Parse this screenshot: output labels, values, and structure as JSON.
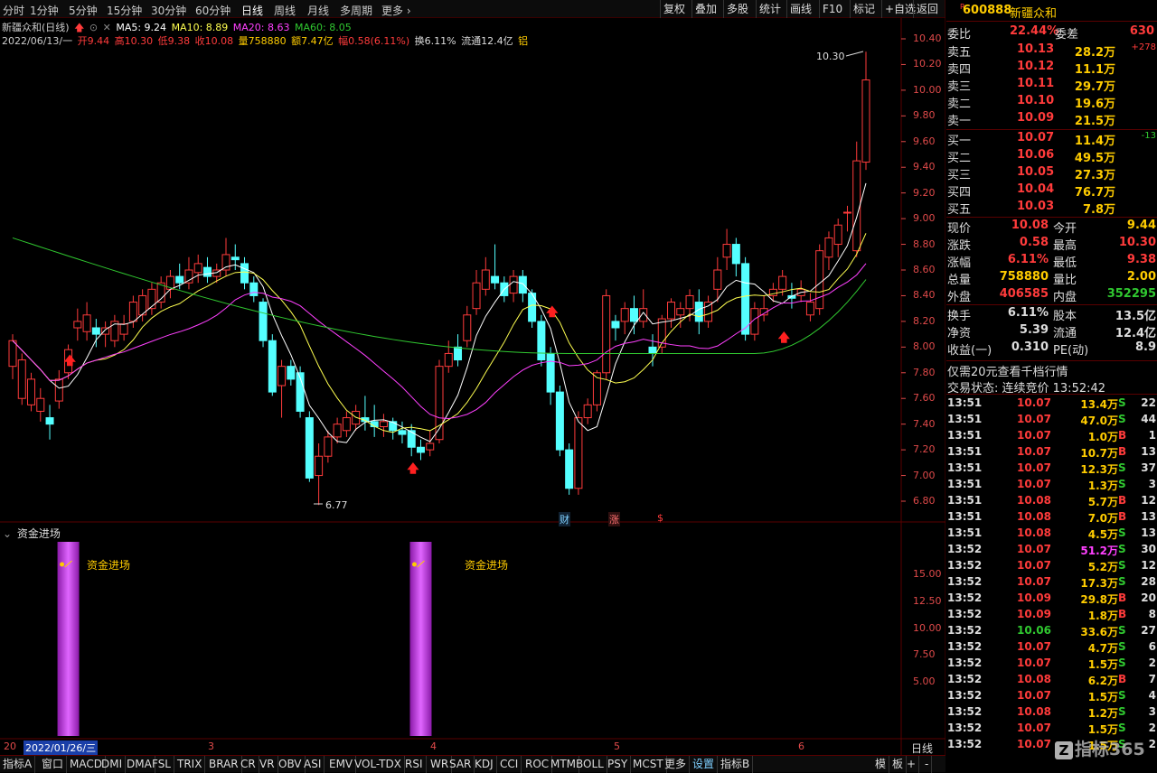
{
  "toolbar": {
    "periods": [
      "分时",
      "1分钟",
      "5分钟",
      "15分钟",
      "30分钟",
      "60分钟",
      "日线",
      "周线",
      "月线",
      "多周期",
      "更多"
    ],
    "active_period": "日线",
    "buttons": [
      "复权",
      "叠加",
      "多股",
      "统计",
      "画线",
      "F10",
      "标记",
      "+自选",
      "返回"
    ]
  },
  "header": {
    "title": "新疆众和(日线)",
    "ma5": "MA5: 9.24",
    "ma10": "MA10: 8.89",
    "ma20": "MA20: 8.63",
    "ma60": "MA60: 8.05",
    "date": "2022/06/13/一",
    "open": "开9.44",
    "high": "高10.30",
    "low": "低9.38",
    "close": "收10.08",
    "vol": "量758880",
    "amount": "额7.47亿",
    "change": "幅0.58(6.11%)",
    "turnover": "换6.11%",
    "float": "流通12.4亿",
    "sector": "铝"
  },
  "price_axis": [
    "10.40",
    "10.20",
    "10.00",
    "9.80",
    "9.60",
    "9.40",
    "9.20",
    "9.00",
    "8.80",
    "8.60",
    "8.40",
    "8.20",
    "8.00",
    "7.80",
    "7.60",
    "7.40",
    "7.20",
    "7.00",
    "6.80"
  ],
  "annotations": {
    "high_mark": "10.30",
    "low_mark": "6.77",
    "badge_cai": "财",
    "badge_zhang": "涨",
    "badge_dollar": "$"
  },
  "indicator": {
    "title": "资金进场",
    "signal_label": "资金进场",
    "axis": [
      "15.00",
      "12.50",
      "10.00",
      "7.50",
      "5.00"
    ]
  },
  "date_axis": {
    "selected": "2022/01/26/三",
    "prefix": "20",
    "months": [
      "3",
      "4",
      "5",
      "6"
    ],
    "period": "日线"
  },
  "bottom_tabs": [
    "指标A",
    "窗口",
    "MACD",
    "DMI",
    "DMA",
    "FSL",
    "TRIX",
    "BRAR",
    "CR",
    "VR",
    "OBV",
    "ASI",
    "EMV",
    "VOL-TDX",
    "RSI",
    "WR",
    "SAR",
    "KDJ",
    "CCI",
    "ROC",
    "MTM",
    "BOLL",
    "PSY",
    "MCST",
    "更多",
    "设置",
    "指标B",
    "模",
    "板"
  ],
  "quote": {
    "code": "600888",
    "name": "新疆众和",
    "weibi_label": "委比",
    "weibi": "22.44%",
    "weicha_label": "委差",
    "weicha": "630",
    "asks": [
      {
        "label": "卖五",
        "price": "10.13",
        "vol": "28.2万",
        "extra": "+278"
      },
      {
        "label": "卖四",
        "price": "10.12",
        "vol": "11.1万",
        "extra": ""
      },
      {
        "label": "卖三",
        "price": "10.11",
        "vol": "29.7万",
        "extra": ""
      },
      {
        "label": "卖二",
        "price": "10.10",
        "vol": "19.6万",
        "extra": ""
      },
      {
        "label": "卖一",
        "price": "10.09",
        "vol": "21.5万",
        "extra": ""
      }
    ],
    "bids": [
      {
        "label": "买一",
        "price": "10.07",
        "vol": "11.4万",
        "extra": "-13"
      },
      {
        "label": "买二",
        "price": "10.06",
        "vol": "49.5万",
        "extra": ""
      },
      {
        "label": "买三",
        "price": "10.05",
        "vol": "27.3万",
        "extra": ""
      },
      {
        "label": "买四",
        "price": "10.04",
        "vol": "76.7万",
        "extra": ""
      },
      {
        "label": "买五",
        "price": "10.03",
        "vol": "7.8万",
        "extra": ""
      }
    ],
    "stats": [
      {
        "l1": "现价",
        "v1": "10.08",
        "l2": "今开",
        "v2": "9.44"
      },
      {
        "l1": "涨跌",
        "v1": "0.58",
        "l2": "最高",
        "v2": "10.30"
      },
      {
        "l1": "涨幅",
        "v1": "6.11%",
        "l2": "最低",
        "v2": "9.38"
      },
      {
        "l1": "总量",
        "v1": "758880",
        "l2": "量比",
        "v2": "2.00"
      },
      {
        "l1": "外盘",
        "v1": "406585",
        "l2": "内盘",
        "v2": "352295"
      }
    ],
    "stats2": [
      {
        "l1": "换手",
        "v1": "6.11%",
        "l2": "股本",
        "v2": "13.5亿"
      },
      {
        "l1": "净资",
        "v1": "5.39",
        "l2": "流通",
        "v2": "12.4亿"
      },
      {
        "l1": "收益(一)",
        "v1": "0.310",
        "l2": "PE(动)",
        "v2": "8.9"
      }
    ],
    "promo": "仅需20元查看千档行情",
    "status": "交易状态: 连续竞价 13:52:42",
    "ticks": [
      {
        "t": "13:51",
        "p": "10.07",
        "v": "13.4万",
        "s": "S",
        "n": "22"
      },
      {
        "t": "13:51",
        "p": "10.07",
        "v": "47.0万",
        "s": "S",
        "n": "44"
      },
      {
        "t": "13:51",
        "p": "10.07",
        "v": "1.0万",
        "s": "B",
        "n": "1"
      },
      {
        "t": "13:51",
        "p": "10.07",
        "v": "10.7万",
        "s": "B",
        "n": "13"
      },
      {
        "t": "13:51",
        "p": "10.07",
        "v": "12.3万",
        "s": "S",
        "n": "37"
      },
      {
        "t": "13:51",
        "p": "10.07",
        "v": "1.3万",
        "s": "S",
        "n": "3"
      },
      {
        "t": "13:51",
        "p": "10.08",
        "v": "5.7万",
        "s": "B",
        "n": "12"
      },
      {
        "t": "13:51",
        "p": "10.08",
        "v": "7.0万",
        "s": "B",
        "n": "13"
      },
      {
        "t": "13:51",
        "p": "10.08",
        "v": "4.5万",
        "s": "S",
        "n": "13"
      },
      {
        "t": "13:52",
        "p": "10.07",
        "v": "51.2万",
        "s": "S",
        "n": "30"
      },
      {
        "t": "13:52",
        "p": "10.07",
        "v": "5.2万",
        "s": "S",
        "n": "12"
      },
      {
        "t": "13:52",
        "p": "10.07",
        "v": "17.3万",
        "s": "S",
        "n": "28"
      },
      {
        "t": "13:52",
        "p": "10.09",
        "v": "29.8万",
        "s": "B",
        "n": "20"
      },
      {
        "t": "13:52",
        "p": "10.09",
        "v": "1.8万",
        "s": "B",
        "n": "8"
      },
      {
        "t": "13:52",
        "p": "10.06",
        "v": "33.6万",
        "s": "S",
        "n": "27"
      },
      {
        "t": "13:52",
        "p": "10.07",
        "v": "4.7万",
        "s": "S",
        "n": "6"
      },
      {
        "t": "13:52",
        "p": "10.07",
        "v": "1.5万",
        "s": "S",
        "n": "2"
      },
      {
        "t": "13:52",
        "p": "10.08",
        "v": "6.2万",
        "s": "B",
        "n": "7"
      },
      {
        "t": "13:52",
        "p": "10.07",
        "v": "1.5万",
        "s": "S",
        "n": "4"
      },
      {
        "t": "13:52",
        "p": "10.08",
        "v": "1.2万",
        "s": "S",
        "n": "3"
      },
      {
        "t": "13:52",
        "p": "10.07",
        "v": "1.5万",
        "s": "S",
        "n": "2"
      },
      {
        "t": "13:52",
        "p": "10.07",
        "v": "1.5万",
        "s": "S",
        "n": "2"
      }
    ],
    "watermark": "指标365"
  },
  "chart_data": {
    "type": "candlestick",
    "title": "新疆众和(日线)",
    "ylim": [
      6.7,
      10.45
    ],
    "candles": [
      [
        7.85,
        8.05,
        7.75,
        8.1
      ],
      [
        7.6,
        7.9,
        7.55,
        7.95
      ],
      [
        7.55,
        7.75,
        7.5,
        7.8
      ],
      [
        7.5,
        7.6,
        7.42,
        7.68
      ],
      [
        7.45,
        7.4,
        7.28,
        7.55
      ],
      [
        7.58,
        7.75,
        7.52,
        7.82
      ],
      [
        7.8,
        7.98,
        7.75,
        8.02
      ],
      [
        8.15,
        8.2,
        8.05,
        8.3
      ],
      [
        8.12,
        8.25,
        8.05,
        8.35
      ],
      [
        8.15,
        8.1,
        8.0,
        8.22
      ],
      [
        8.1,
        8.15,
        8.0,
        8.2
      ],
      [
        8.05,
        8.2,
        8.0,
        8.25
      ],
      [
        8.1,
        8.18,
        8.05,
        8.25
      ],
      [
        8.2,
        8.35,
        8.15,
        8.4
      ],
      [
        8.25,
        8.4,
        8.2,
        8.45
      ],
      [
        8.3,
        8.45,
        8.25,
        8.5
      ],
      [
        8.35,
        8.5,
        8.3,
        8.55
      ],
      [
        8.45,
        8.55,
        8.38,
        8.6
      ],
      [
        8.55,
        8.5,
        8.45,
        8.65
      ],
      [
        8.5,
        8.6,
        8.45,
        8.7
      ],
      [
        8.58,
        8.65,
        8.5,
        8.72
      ],
      [
        8.62,
        8.55,
        8.5,
        8.7
      ],
      [
        8.55,
        8.6,
        8.5,
        8.65
      ],
      [
        8.6,
        8.72,
        8.55,
        8.85
      ],
      [
        8.7,
        8.68,
        8.6,
        8.8
      ],
      [
        8.65,
        8.5,
        8.45,
        8.7
      ],
      [
        8.5,
        8.4,
        8.35,
        8.55
      ],
      [
        8.35,
        8.05,
        8.0,
        8.38
      ],
      [
        8.05,
        7.65,
        7.62,
        8.1
      ],
      [
        7.7,
        7.85,
        7.45,
        7.9
      ],
      [
        7.85,
        7.75,
        7.7,
        7.9
      ],
      [
        7.8,
        7.5,
        7.45,
        7.85
      ],
      [
        7.45,
        6.98,
        6.95,
        7.5
      ],
      [
        7.0,
        7.15,
        6.77,
        7.25
      ],
      [
        7.15,
        7.3,
        7.1,
        7.35
      ],
      [
        7.3,
        7.4,
        7.25,
        7.45
      ],
      [
        7.35,
        7.45,
        7.3,
        7.5
      ],
      [
        7.4,
        7.5,
        7.35,
        7.55
      ],
      [
        7.45,
        7.42,
        7.35,
        7.62
      ],
      [
        7.42,
        7.38,
        7.3,
        7.55
      ],
      [
        7.38,
        7.42,
        7.3,
        7.48
      ],
      [
        7.42,
        7.35,
        7.28,
        7.45
      ],
      [
        7.35,
        7.32,
        7.25,
        7.42
      ],
      [
        7.35,
        7.22,
        7.15,
        7.4
      ],
      [
        7.22,
        7.18,
        7.12,
        7.28
      ],
      [
        7.2,
        7.25,
        7.15,
        7.35
      ],
      [
        7.28,
        7.85,
        7.25,
        7.9
      ],
      [
        7.85,
        7.95,
        7.8,
        8.05
      ],
      [
        8.0,
        7.9,
        7.85,
        8.1
      ],
      [
        8.05,
        8.25,
        8.0,
        8.32
      ],
      [
        8.3,
        8.5,
        8.25,
        8.6
      ],
      [
        8.45,
        8.6,
        8.4,
        8.7
      ],
      [
        8.55,
        8.5,
        8.45,
        8.8
      ],
      [
        8.5,
        8.4,
        8.35,
        8.55
      ],
      [
        8.42,
        8.55,
        8.35,
        8.6
      ],
      [
        8.55,
        8.42,
        8.35,
        8.6
      ],
      [
        8.42,
        8.2,
        8.15,
        8.45
      ],
      [
        8.2,
        7.9,
        7.85,
        8.25
      ],
      [
        7.95,
        7.65,
        7.55,
        8.0
      ],
      [
        7.65,
        7.2,
        7.15,
        7.7
      ],
      [
        7.2,
        6.9,
        6.85,
        7.25
      ],
      [
        6.9,
        7.45,
        6.85,
        7.5
      ],
      [
        7.45,
        7.55,
        7.4,
        7.6
      ],
      [
        7.55,
        7.8,
        7.5,
        7.82
      ],
      [
        7.8,
        8.4,
        7.75,
        8.45
      ],
      [
        8.2,
        8.15,
        8.05,
        8.25
      ],
      [
        8.2,
        8.3,
        8.1,
        8.35
      ],
      [
        8.3,
        8.2,
        8.1,
        8.4
      ],
      [
        8.2,
        8.3,
        8.15,
        8.45
      ],
      [
        8.0,
        7.95,
        7.85,
        8.1
      ],
      [
        8.0,
        8.22,
        7.95,
        8.25
      ],
      [
        8.22,
        8.35,
        8.15,
        8.38
      ],
      [
        8.25,
        8.3,
        8.15,
        8.35
      ],
      [
        8.3,
        8.4,
        8.2,
        8.45
      ],
      [
        8.35,
        8.2,
        8.1,
        8.45
      ],
      [
        8.2,
        8.35,
        8.15,
        8.4
      ],
      [
        8.45,
        8.6,
        8.35,
        8.7
      ],
      [
        8.7,
        8.8,
        8.6,
        8.92
      ],
      [
        8.8,
        8.65,
        8.55,
        8.85
      ],
      [
        8.65,
        8.1,
        8.05,
        8.7
      ],
      [
        8.1,
        8.3,
        8.05,
        8.35
      ],
      [
        8.25,
        8.3,
        8.2,
        8.4
      ],
      [
        8.4,
        8.45,
        8.35,
        8.5
      ],
      [
        8.45,
        8.55,
        8.4,
        8.6
      ],
      [
        8.4,
        8.38,
        8.3,
        8.5
      ],
      [
        8.4,
        8.45,
        8.35,
        8.52
      ],
      [
        8.25,
        8.35,
        8.2,
        8.42
      ],
      [
        8.3,
        8.75,
        8.25,
        8.8
      ],
      [
        8.7,
        8.85,
        8.6,
        8.9
      ],
      [
        8.8,
        8.95,
        8.7,
        9.0
      ],
      [
        9.05,
        9.05,
        8.9,
        9.1
      ],
      [
        8.75,
        9.45,
        8.7,
        9.6
      ],
      [
        9.44,
        10.08,
        9.38,
        10.3
      ]
    ],
    "ma_labels": [
      "MA5",
      "MA10",
      "MA20",
      "MA60"
    ],
    "signal_bars": [
      {
        "index": 6,
        "value": 18
      },
      {
        "index": 44,
        "value": 18
      }
    ]
  },
  "colors": {
    "up": "#ff3b3b",
    "down": "#54ffff",
    "ma5": "#ffffff",
    "ma10": "#ffff50",
    "ma20": "#ff40ff",
    "ma60": "#30c830",
    "accent": "#ffcc00",
    "grid": "#5a0000"
  }
}
